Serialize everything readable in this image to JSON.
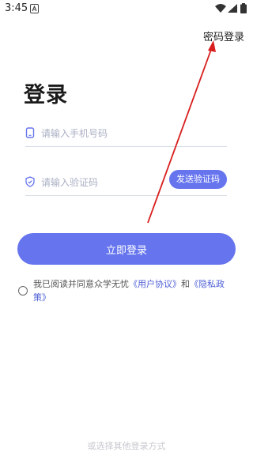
{
  "status_bar": {
    "time": "3:45"
  },
  "header": {
    "switch_label": "密码登录"
  },
  "page": {
    "title": "登录"
  },
  "phone": {
    "placeholder": "请输入手机号码"
  },
  "code": {
    "placeholder": "请输入验证码",
    "send_label": "发送验证码"
  },
  "login": {
    "label": "立即登录"
  },
  "agreement": {
    "prefix": "我已阅读并同意众学无忧",
    "user_agreement": "《用户协议》",
    "and": "和",
    "privacy_policy": "《隐私政策》"
  },
  "footer": {
    "other_login": "或选择其他登录方式"
  },
  "colors": {
    "accent": "#6675ee",
    "link": "#4d5fd6",
    "annotation": "#d81e1e"
  }
}
